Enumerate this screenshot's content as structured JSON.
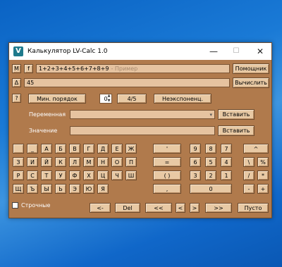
{
  "window": {
    "title": "Калькулятор LV-Calc 1.0",
    "controls": {
      "minimize": "—",
      "maximize": "☐",
      "close": "✕"
    }
  },
  "row1": {
    "m_btn": "М",
    "f_btn": "f",
    "expression": "1+2+3+4+5+6+7+8+9",
    "hint": "- Пример",
    "helper_btn": "Помощник"
  },
  "row2": {
    "delta_btn": "Δ",
    "result": "45",
    "calc_btn": "Вычислить"
  },
  "row3": {
    "help_btn": "?",
    "min_order_btn": "Мин. порядок",
    "spin_value": "0",
    "fraction_btn": "4/5",
    "nonexp_btn": "Неэкспоненц."
  },
  "variable": {
    "label": "Переменная",
    "insert_btn": "Вставить"
  },
  "value": {
    "label": "Значение",
    "insert_btn": "Вставить"
  },
  "letters": [
    [
      "",
      "_",
      "А",
      "Б",
      "В",
      "Г",
      "Д",
      "Е",
      "Ж"
    ],
    [
      "З",
      "И",
      "Й",
      "К",
      "Л",
      "М",
      "Н",
      "О",
      "П"
    ],
    [
      "Р",
      "С",
      "Т",
      "У",
      "Ф",
      "Х",
      "Ц",
      "Ч",
      "Ш"
    ],
    [
      "Щ",
      "Ъ",
      "Ы",
      "Ь",
      "Э",
      "Ю",
      "Я"
    ]
  ],
  "symbols": [
    "'",
    "=",
    "( )",
    ","
  ],
  "digits": [
    [
      "9",
      "8",
      "7"
    ],
    [
      "6",
      "5",
      "4"
    ],
    [
      "3",
      "2",
      "1"
    ],
    [
      "0"
    ]
  ],
  "ops": [
    [
      "^",
      ""
    ],
    [
      "\\",
      "%"
    ],
    [
      "/",
      "*"
    ],
    [
      "-",
      "+"
    ]
  ],
  "lowercase": {
    "label": "Строчные",
    "checked": false
  },
  "bottom": {
    "back": "<-",
    "del": "Del",
    "prev_prev": "<<",
    "prev": "<",
    "next": ">",
    "next_next": ">>",
    "empty": "Пусто"
  },
  "colors": {
    "window_bg": "#b07a4c",
    "button_bg": "#e8c9a4",
    "field_bg": "#e6c3a0",
    "desktop": "#1a7ad6"
  }
}
